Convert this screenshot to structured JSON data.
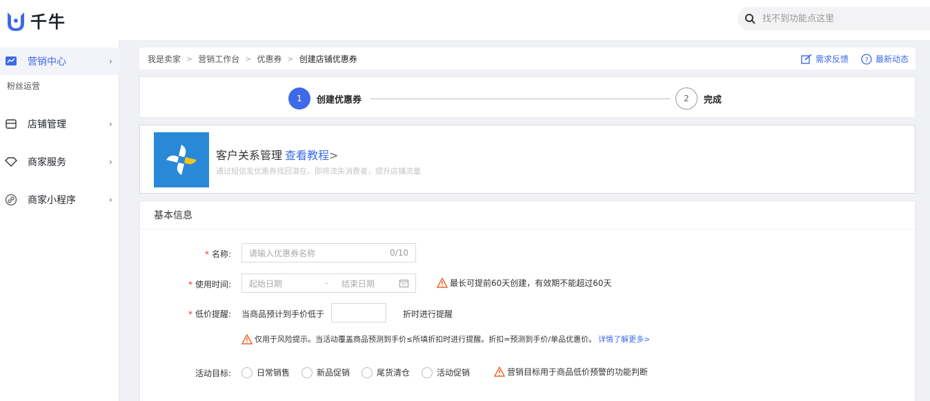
{
  "app": {
    "name": "千牛"
  },
  "search": {
    "placeholder": "找不到功能点这里"
  },
  "sidebar": {
    "items": [
      {
        "label": "营销中心",
        "icon": "chart-icon",
        "active": true
      },
      {
        "label": "店铺管理",
        "icon": "store-icon"
      },
      {
        "label": "商家服务",
        "icon": "diamond-icon"
      },
      {
        "label": "商家小程序",
        "icon": "link-icon"
      }
    ],
    "sub_label": "粉丝运营"
  },
  "breadcrumb": {
    "items": [
      "我是卖家",
      "营销工作台",
      "优惠券",
      "创建店铺优惠券"
    ],
    "separator": ">",
    "actions": {
      "feedback": "需求反馈",
      "news": "最新动态"
    }
  },
  "steps": [
    {
      "number": "1",
      "label": "创建优惠券",
      "active": true
    },
    {
      "number": "2",
      "label": "完成",
      "active": false
    }
  ],
  "promo": {
    "title": "客户关系管理",
    "link": "查看教程",
    "arrow": ">",
    "desc": "通过短信发优惠券找回潜在、即将流失消费者，提升店铺流量"
  },
  "form": {
    "section_title": "基本信息",
    "required_mark": "*",
    "name": {
      "label": "名称:",
      "placeholder": "请输入优惠券名称",
      "counter": "0/10"
    },
    "time": {
      "label": "使用时间:",
      "start_placeholder": "起始日期",
      "sep": "-",
      "end_placeholder": "结束日期",
      "warning": "最长可提前60天创建，有效期不能超过60天"
    },
    "price": {
      "label": "低价提醒:",
      "prefix": "当商品预计到手价低于",
      "suffix": "折时进行提醒",
      "warning": "仅用于风险提示。当活动覆盖商品预测到手价≤所填折扣时进行提醒。折扣=预测到手价/单品优惠价。",
      "link": "详情了解更多>"
    },
    "goal": {
      "label": "活动目标:",
      "options": [
        "日常销售",
        "新品促销",
        "尾货清仓",
        "活动促销"
      ],
      "warning": "营销目标用于商品低价预警的功能判断"
    }
  },
  "colors": {
    "accent": "#3d6ae8",
    "warning": "#e8692c",
    "required": "#e33333"
  }
}
